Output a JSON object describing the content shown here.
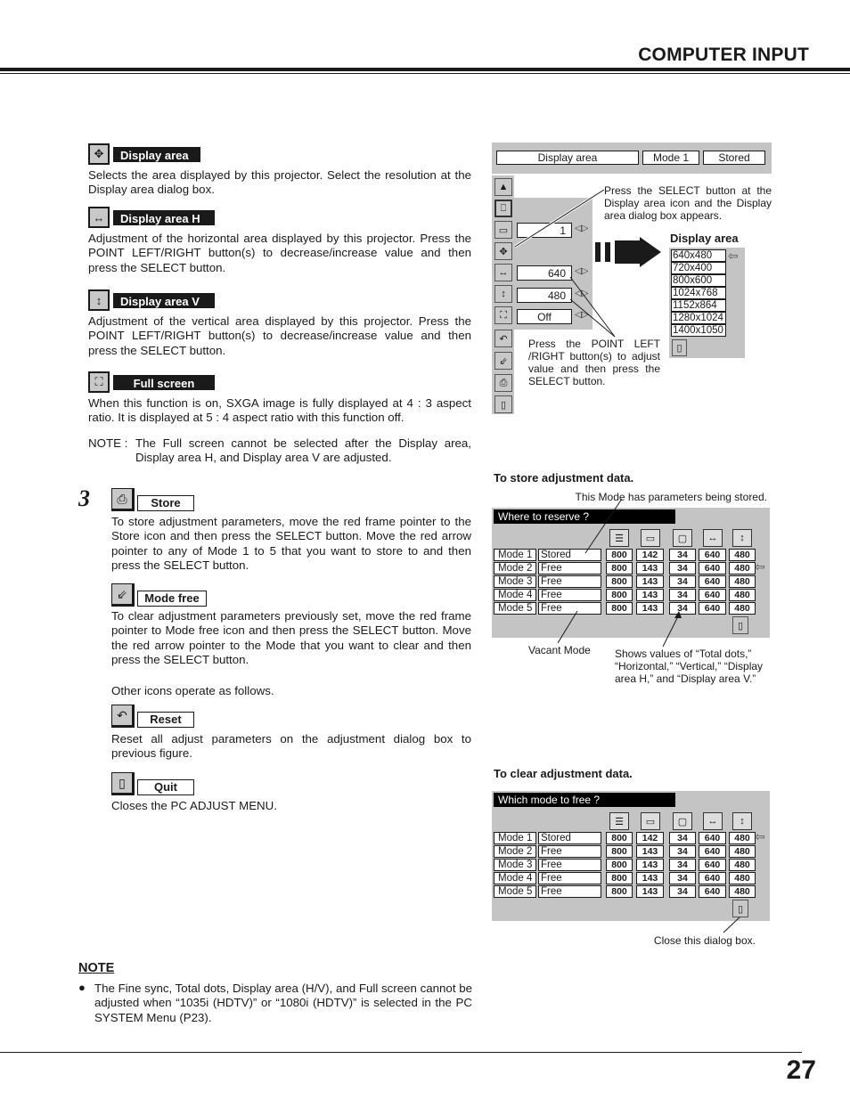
{
  "header": {
    "title": "COMPUTER INPUT"
  },
  "page_number": "27",
  "sections": [
    {
      "label": "Display area",
      "icon": "display-area-icon",
      "text": "Selects the area displayed by this projector.  Select the resolution at the Display area dialog box."
    },
    {
      "label": "Display area H",
      "icon": "display-area-h-icon",
      "text": "Adjustment of the horizontal area displayed by this projector.  Press the POINT LEFT/RIGHT button(s) to decrease/increase value and then press the SELECT button."
    },
    {
      "label": "Display area V",
      "icon": "display-area-v-icon",
      "text": "Adjustment of the vertical area displayed by this projector.  Press the POINT LEFT/RIGHT button(s) to decrease/increase value and then press the SELECT button."
    },
    {
      "label": "Full screen",
      "icon": "full-screen-icon",
      "text": "When this function is on, SXGA image is fully displayed at 4 : 3 aspect ratio.  It is displayed at 5 : 4 aspect ratio with this function off."
    }
  ],
  "full_screen_note": {
    "prefix": "NOTE :",
    "text": "The Full screen cannot be selected after the Display area, Display area H, and Display area V are adjusted."
  },
  "step": {
    "number": "3",
    "items": [
      {
        "label": "Store",
        "icon": "store-icon",
        "text": "To store adjustment parameters, move the red frame pointer to the Store icon and then press the SELECT button.  Move the red arrow pointer to any of Mode 1 to 5 that you want to store to and then press the SELECT button."
      },
      {
        "label": "Mode free",
        "icon": "mode-free-icon",
        "text": "To clear adjustment parameters previously set, move the red frame pointer to Mode free icon and then press the SELECT button.  Move the red arrow pointer to the Mode that you want to clear and then press the SELECT button."
      }
    ],
    "other_icons_intro": "Other icons operate as follows.",
    "other_items": [
      {
        "label": "Reset",
        "icon": "reset-icon",
        "text": "Reset all adjust parameters on the adjustment dialog box to previous figure."
      },
      {
        "label": "Quit",
        "icon": "quit-icon",
        "text": "Closes the PC ADJUST MENU."
      }
    ]
  },
  "bottom_note": {
    "heading": "NOTE",
    "text": "The Fine sync, Total dots, Display area (H/V), and Full screen cannot be adjusted when “1035i (HDTV)” or “1080i (HDTV)” is selected in the PC SYSTEM Menu (P23)."
  },
  "menu_figure": {
    "top_bar": {
      "item": "Display area",
      "mode": "Mode 1",
      "status": "Stored"
    },
    "values": {
      "display_area": "1",
      "h": "640",
      "v": "480",
      "full_screen": "Off"
    },
    "callout_select": "Press the SELECT button at the Display area icon and the Display area dialog box appears.",
    "callout_point": "Press the POINT LEFT /RIGHT button(s) to adjust value and then press the SELECT button.",
    "dialog_title": "Display area",
    "resolutions": [
      "640x480",
      "720x400",
      "800x600",
      "1024x768",
      "1152x864",
      "1280x1024",
      "1400x1050"
    ]
  },
  "store_figure": {
    "caption": "To store adjustment data.",
    "callout_top": "This Mode has parameters being stored.",
    "title": "Where to reserve ?",
    "callout_vacant": "Vacant Mode",
    "callout_values": "Shows values of “Total dots,” “Horizontal,” “Vertical,” “Display area H,” and “Display area V.”",
    "pointer_row": 2
  },
  "clear_figure": {
    "caption": "To clear adjustment data.",
    "title": "Which mode to free ?",
    "callout_close": "Close this dialog box.",
    "pointer_row": 1
  },
  "modes": [
    {
      "mode": "Mode 1",
      "status": "Stored",
      "values": [
        "800",
        "142",
        "34",
        "640",
        "480"
      ]
    },
    {
      "mode": "Mode 2",
      "status": "Free",
      "values": [
        "800",
        "143",
        "34",
        "640",
        "480"
      ]
    },
    {
      "mode": "Mode 3",
      "status": "Free",
      "values": [
        "800",
        "143",
        "34",
        "640",
        "480"
      ]
    },
    {
      "mode": "Mode 4",
      "status": "Free",
      "values": [
        "800",
        "143",
        "34",
        "640",
        "480"
      ]
    },
    {
      "mode": "Mode 5",
      "status": "Free",
      "values": [
        "800",
        "143",
        "34",
        "640",
        "480"
      ]
    }
  ]
}
